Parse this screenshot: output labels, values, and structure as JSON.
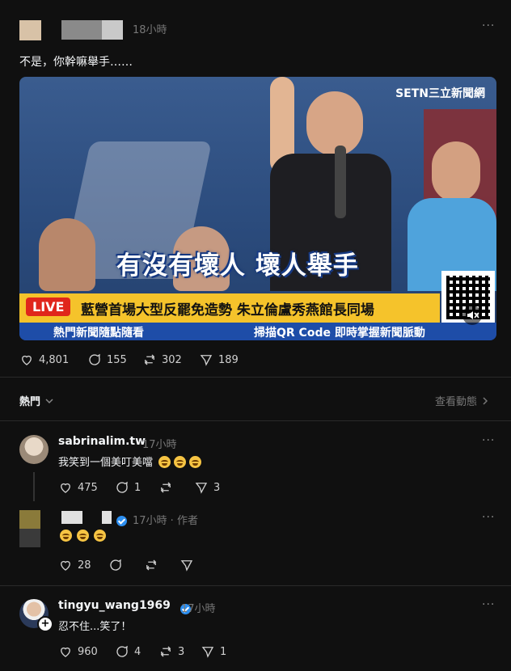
{
  "post": {
    "time": "18小時",
    "text": "不是，你幹嘛舉手……",
    "more": "···",
    "video": {
      "brand": "SETN三立新聞網",
      "caption": "有沒有壞人 壞人舉手",
      "live": "LIVE",
      "headline": "藍營首場大型反罷免造勢 朱立倫盧秀燕館長同場",
      "ticker_left": "熱門新聞隨點隨看",
      "ticker_right": "掃描QR Code 即時掌握新聞脈動",
      "icon": "mute-icon"
    },
    "stats": {
      "likes": "4,801",
      "comments": "155",
      "reposts": "302",
      "shares": "189"
    }
  },
  "filter": {
    "label": "熱門",
    "activity": "查看動態"
  },
  "comments": [
    {
      "user": "sabrinalim.tw",
      "time": "17小時",
      "text": "我笑到一個美叮美噹",
      "emojis": 3,
      "stats": {
        "likes": "475",
        "comments": "1",
        "reposts": "",
        "shares": "3"
      }
    },
    {
      "user": "",
      "time": "17小時 · 作者",
      "text": "",
      "emojis": 3,
      "stats": {
        "likes": "28",
        "comments": "",
        "reposts": "",
        "shares": ""
      }
    },
    {
      "user": "tingyu_wang1969",
      "time": "17小時",
      "text": "忍不住...笑了！",
      "stats": {
        "likes": "960",
        "comments": "4",
        "reposts": "3",
        "shares": "1"
      }
    }
  ],
  "colors": {
    "background": "#101010",
    "live": "#e0261b",
    "banner": "#f5c32b",
    "ticker": "#1e4da8",
    "verified": "#2d8ff0"
  }
}
